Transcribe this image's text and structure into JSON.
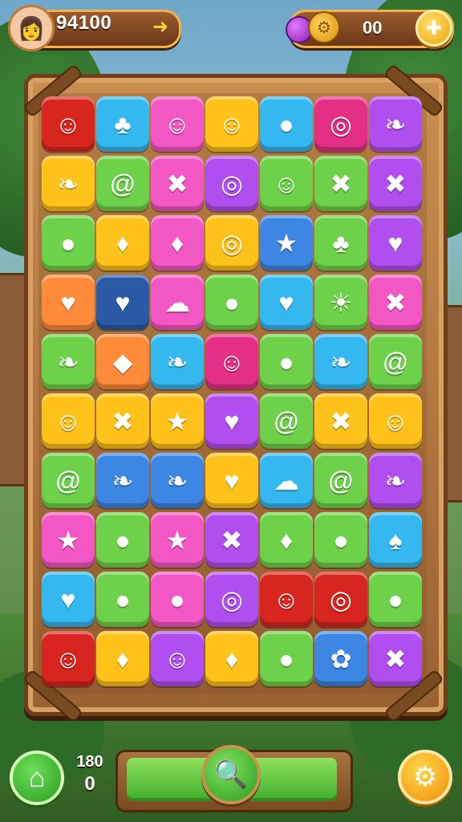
{
  "hud": {
    "score": "94100",
    "coins": "00",
    "avatar_icon": "👩",
    "arrow_icon": "➜",
    "plus_icon": "✚",
    "gem_icon": "gem-icon",
    "gear_coin_icon": "⚙"
  },
  "bottom": {
    "counter_top": "180",
    "counter_bottom": "0",
    "home_icon": "⌂",
    "search_icon": "🔍",
    "settings_icon": "⚙"
  },
  "tile_colors": {
    "red": "#d9251f",
    "cyan": "#35b8ef",
    "pink": "#f257c4",
    "yellow": "#ffc21a",
    "purple": "#b14ef0",
    "green": "#6ed14a",
    "blue": "#3d86e3",
    "navy": "#2a5aa6",
    "orange": "#ff8a3a",
    "magenta": "#e42f86"
  },
  "board": [
    [
      [
        "red",
        "face"
      ],
      [
        "cyan",
        "pine"
      ],
      [
        "pink",
        "face"
      ],
      [
        "yellow",
        "face"
      ],
      [
        "cyan",
        "lemon"
      ],
      [
        "magenta",
        "swirl"
      ],
      [
        "purple",
        "leaf"
      ]
    ],
    [
      [
        "yellow",
        "leaf"
      ],
      [
        "green",
        "spiral"
      ],
      [
        "pink",
        "cross"
      ],
      [
        "purple",
        "swirl"
      ],
      [
        "green",
        "face"
      ],
      [
        "green",
        "cross"
      ],
      [
        "purple",
        "cross"
      ]
    ],
    [
      [
        "green",
        "berry"
      ],
      [
        "yellow",
        "apple"
      ],
      [
        "pink",
        "apple"
      ],
      [
        "yellow",
        "swirl"
      ],
      [
        "blue",
        "star"
      ],
      [
        "green",
        "blob"
      ],
      [
        "purple",
        "heart"
      ]
    ],
    [
      [
        "orange",
        "heart"
      ],
      [
        "navy",
        "heart"
      ],
      [
        "pink",
        "cloud"
      ],
      [
        "green",
        "lemon"
      ],
      [
        "cyan",
        "heart"
      ],
      [
        "green",
        "sun"
      ],
      [
        "pink",
        "cross"
      ]
    ],
    [
      [
        "green",
        "leaf"
      ],
      [
        "orange",
        "gem"
      ],
      [
        "cyan",
        "leaf"
      ],
      [
        "magenta",
        "face"
      ],
      [
        "green",
        "orange"
      ],
      [
        "cyan",
        "leaf"
      ],
      [
        "green",
        "spiral"
      ]
    ],
    [
      [
        "yellow",
        "face"
      ],
      [
        "yellow",
        "cross"
      ],
      [
        "yellow",
        "star"
      ],
      [
        "purple",
        "heart"
      ],
      [
        "green",
        "spiral"
      ],
      [
        "yellow",
        "cross"
      ],
      [
        "yellow",
        "face"
      ]
    ],
    [
      [
        "green",
        "spiral"
      ],
      [
        "blue",
        "leaf"
      ],
      [
        "blue",
        "leaf"
      ],
      [
        "yellow",
        "heart"
      ],
      [
        "cyan",
        "cloud"
      ],
      [
        "green",
        "spiral"
      ],
      [
        "purple",
        "leaf"
      ]
    ],
    [
      [
        "pink",
        "star"
      ],
      [
        "green",
        "orange"
      ],
      [
        "pink",
        "star"
      ],
      [
        "purple",
        "cross"
      ],
      [
        "green",
        "apple"
      ],
      [
        "green",
        "lemon"
      ],
      [
        "cyan",
        "shell"
      ]
    ],
    [
      [
        "cyan",
        "heart"
      ],
      [
        "green",
        "berry"
      ],
      [
        "pink",
        "orange"
      ],
      [
        "purple",
        "swirl"
      ],
      [
        "red",
        "face"
      ],
      [
        "red",
        "swirl"
      ],
      [
        "green",
        "berry"
      ]
    ],
    [
      [
        "red",
        "face"
      ],
      [
        "yellow",
        "apple"
      ],
      [
        "purple",
        "face"
      ],
      [
        "yellow",
        "apple"
      ],
      [
        "green",
        "orange"
      ],
      [
        "blue",
        "flower"
      ],
      [
        "purple",
        "cross"
      ]
    ]
  ]
}
